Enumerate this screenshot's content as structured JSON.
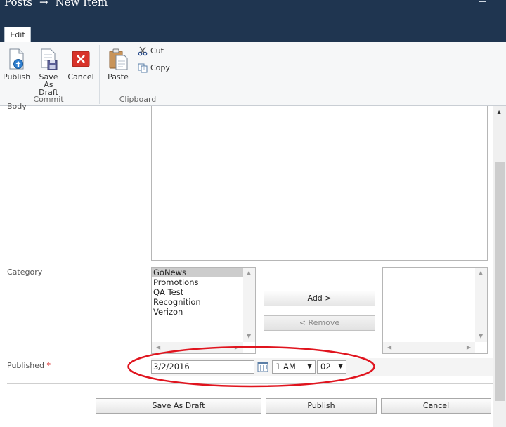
{
  "window": {
    "breadcrumb_root": "Posts",
    "breadcrumb_sep": "→",
    "breadcrumb_page": "New Item"
  },
  "ribbon": {
    "tab": "Edit",
    "commit": {
      "label": "Commit",
      "publish": "Publish",
      "save_draft_1": "Save As",
      "save_draft_2": "Draft",
      "cancel": "Cancel"
    },
    "clipboard": {
      "label": "Clipboard",
      "paste": "Paste",
      "cut": "Cut",
      "copy": "Copy"
    }
  },
  "form": {
    "body_label": "Body",
    "category_label": "Category",
    "category_options": [
      "GoNews",
      "Promotions",
      "QA Test",
      "Recognition",
      "Verizon"
    ],
    "selected_option": "GoNews",
    "add_button": "Add >",
    "remove_button": "< Remove",
    "published_label": "Published",
    "required_mark": "*",
    "published_date": "3/2/2016",
    "published_hour": "1 AM",
    "published_minute": "02"
  },
  "footer": {
    "save_draft": "Save As Draft",
    "publish": "Publish",
    "cancel": "Cancel"
  },
  "colors": {
    "titlebar": "#1f3550",
    "annotation": "#e0141e"
  }
}
